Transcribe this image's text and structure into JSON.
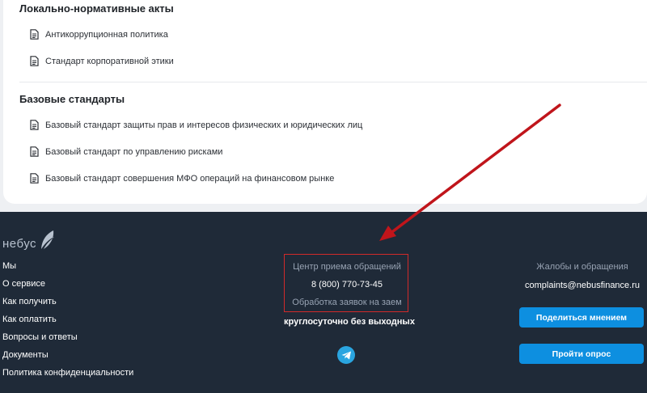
{
  "documents": {
    "sections": [
      {
        "title": "Локально-нормативные акты",
        "items": [
          "Антикоррупционная политика",
          "Стандарт корпоративной этики"
        ]
      },
      {
        "title": "Базовые стандарты",
        "items": [
          "Базовый стандарт защиты прав и интересов физических и юридических лиц",
          "Базовый стандарт по управлению рисками",
          "Базовый стандарт совершения МФО операций на финансовом рынке"
        ]
      }
    ],
    "item_icon": "document-icon"
  },
  "footer": {
    "logo_text": "небус",
    "nav": [
      "Мы",
      "О сервисе",
      "Как получить",
      "Как оплатить",
      "Вопросы и ответы",
      "Документы",
      "Политика конфиденциальности"
    ],
    "center": {
      "title": "Центр приема обращений",
      "phone": "8 (800) 770-73-45",
      "subtitle": "Обработка заявок на заем",
      "hours": "круглосуточно без выходных",
      "social_icon": "telegram-icon"
    },
    "right": {
      "title": "Жалобы и обращения",
      "email": "complaints@nebusfinance.ru",
      "share_button": "Поделиться мнением",
      "survey_button": "Пройти опрос"
    }
  },
  "colors": {
    "footer_bg": "#1f2a38",
    "button_bg": "#0d8fe0",
    "highlight_border": "#d12a2a",
    "arrow": "#c0151b"
  }
}
